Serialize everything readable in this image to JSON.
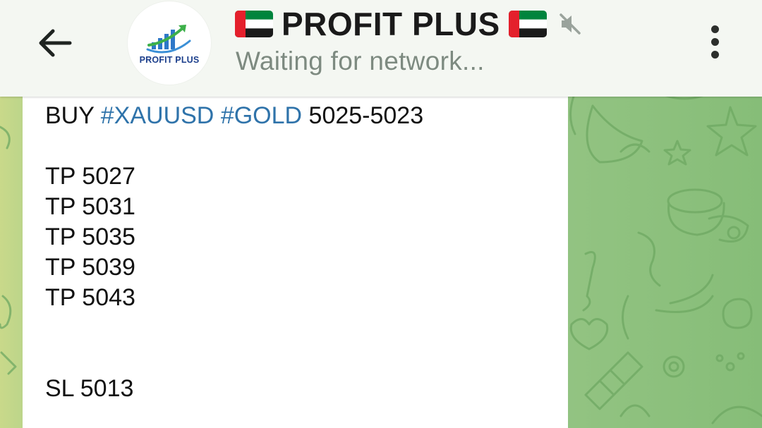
{
  "header": {
    "title": "PROFIT PLUS",
    "status": "Waiting for network...",
    "avatar_text": "PROFIT PLUS",
    "flag_left_icon": "uae-flag-icon",
    "flag_right_icon": "uae-flag-icon",
    "muted_icon": "speaker-muted-icon",
    "back_icon": "arrow-left-icon",
    "menu_icon": "more-vertical-icon"
  },
  "message": {
    "action": "BUY",
    "hashtag_1": "#XAUUSD",
    "hashtag_2": "#GOLD",
    "entry_range": "5025-5023",
    "tp1": "TP 5027",
    "tp2": "TP 5031",
    "tp3": "TP 5035",
    "tp4": "TP 5039",
    "tp5": "TP 5043",
    "sl": "SL 5013"
  },
  "colors": {
    "header_bg": "#f4f7f2",
    "hashtag": "#2f73aa",
    "wallpaper": "#8cbf7d",
    "bubble_bg": "#ffffff",
    "status_text": "#7d8a80"
  }
}
